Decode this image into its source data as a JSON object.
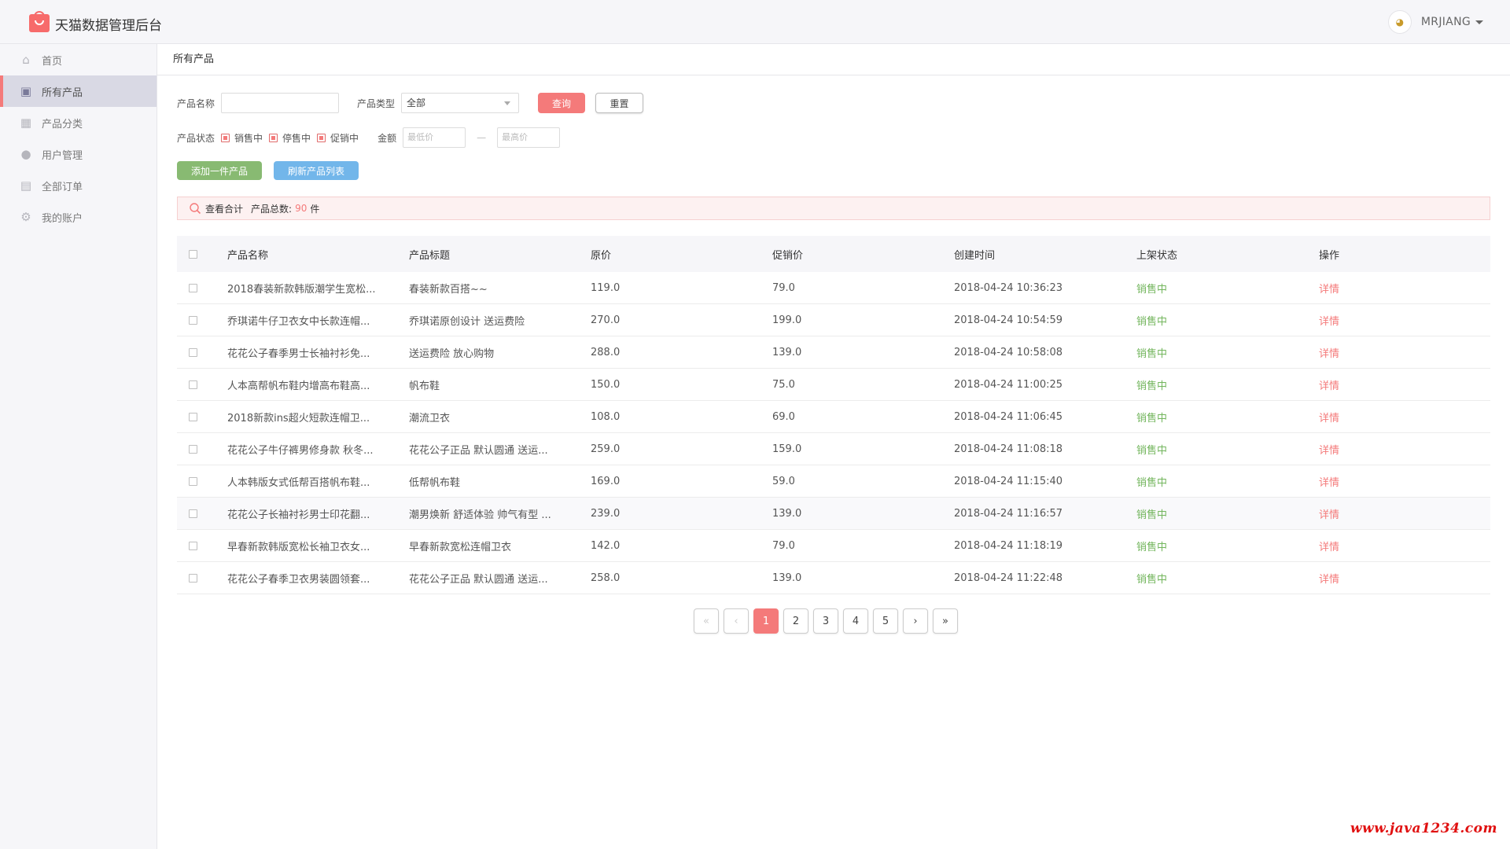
{
  "app": {
    "title": "天猫数据管理后台"
  },
  "user": {
    "name": "MRJIANG",
    "avatar_glyph": "◕"
  },
  "sidebar": {
    "items": [
      {
        "label": "首页",
        "icon": "home-icon",
        "glyph": "⌂"
      },
      {
        "label": "所有产品",
        "icon": "bag-icon",
        "glyph": "▣",
        "active": true
      },
      {
        "label": "产品分类",
        "icon": "grid-icon",
        "glyph": "▦"
      },
      {
        "label": "用户管理",
        "icon": "user-icon",
        "glyph": "●"
      },
      {
        "label": "全部订单",
        "icon": "list-icon",
        "glyph": "▤"
      },
      {
        "label": "我的账户",
        "icon": "gear-icon",
        "glyph": "⚙"
      }
    ]
  },
  "breadcrumb": "所有产品",
  "filters": {
    "name_label": "产品名称",
    "type_label": "产品类型",
    "type_value": "全部",
    "query_button": "查询",
    "reset_button": "重置",
    "status_label": "产品状态",
    "status_options": [
      "销售中",
      "停售中",
      "促销中"
    ],
    "amount_label": "金额",
    "min_placeholder": "最低价",
    "max_placeholder": "最高价",
    "range_sep": "—"
  },
  "actions": {
    "add": "添加一件产品",
    "refresh": "刷新产品列表"
  },
  "summary": {
    "text": "查看合计",
    "count_label": "产品总数:",
    "count": "90",
    "unit": "件"
  },
  "table": {
    "headers": [
      "产品名称",
      "产品标题",
      "原价",
      "促销价",
      "创建时间",
      "上架状态",
      "操作"
    ],
    "rows": [
      {
        "name": "2018春装新款韩版潮学生宽松...",
        "title": "春装新款百搭~~",
        "price": "119.0",
        "promo": "79.0",
        "created": "2018-04-24 10:36:23",
        "status": "销售中",
        "op": "详情"
      },
      {
        "name": "乔琪诺牛仔卫衣女中长款连帽...",
        "title": "乔琪诺原创设计 送运费险",
        "price": "270.0",
        "promo": "199.0",
        "created": "2018-04-24 10:54:59",
        "status": "销售中",
        "op": "详情"
      },
      {
        "name": "花花公子春季男士长袖衬衫免...",
        "title": "送运费险 放心购物",
        "price": "288.0",
        "promo": "139.0",
        "created": "2018-04-24 10:58:08",
        "status": "销售中",
        "op": "详情"
      },
      {
        "name": "人本高帮帆布鞋内增高布鞋高...",
        "title": "帆布鞋",
        "price": "150.0",
        "promo": "75.0",
        "created": "2018-04-24 11:00:25",
        "status": "销售中",
        "op": "详情"
      },
      {
        "name": "2018新款ins超火短款连帽卫...",
        "title": "潮流卫衣",
        "price": "108.0",
        "promo": "69.0",
        "created": "2018-04-24 11:06:45",
        "status": "销售中",
        "op": "详情"
      },
      {
        "name": "花花公子牛仔裤男修身款 秋冬...",
        "title": "花花公子正品 默认圆通 送运...",
        "price": "259.0",
        "promo": "159.0",
        "created": "2018-04-24 11:08:18",
        "status": "销售中",
        "op": "详情"
      },
      {
        "name": "人本韩版女式低帮百搭帆布鞋...",
        "title": "低帮帆布鞋",
        "price": "169.0",
        "promo": "59.0",
        "created": "2018-04-24 11:15:40",
        "status": "销售中",
        "op": "详情"
      },
      {
        "name": "花花公子长袖衬衫男士印花翻...",
        "title": "潮男焕新 舒适体验 帅气有型 ...",
        "price": "239.0",
        "promo": "139.0",
        "created": "2018-04-24 11:16:57",
        "status": "销售中",
        "op": "详情"
      },
      {
        "name": "早春新款韩版宽松长袖卫衣女...",
        "title": "早春新款宽松连帽卫衣",
        "price": "142.0",
        "promo": "79.0",
        "created": "2018-04-24 11:18:19",
        "status": "销售中",
        "op": "详情"
      },
      {
        "name": "花花公子春季卫衣男装圆领套...",
        "title": "花花公子正品 默认圆通 送运...",
        "price": "258.0",
        "promo": "139.0",
        "created": "2018-04-24 11:22:48",
        "status": "销售中",
        "op": "详情"
      }
    ]
  },
  "pagination": {
    "first": "«",
    "prev": "‹",
    "pages": [
      "1",
      "2",
      "3",
      "4",
      "5"
    ],
    "current": "1",
    "next": "›",
    "last": "»"
  },
  "watermark": "www.java1234.com",
  "colors": {
    "accent": "#f47a7a",
    "status_green": "#72b55c",
    "add_button": "#88ba72",
    "refresh_button": "#72b6ea"
  }
}
